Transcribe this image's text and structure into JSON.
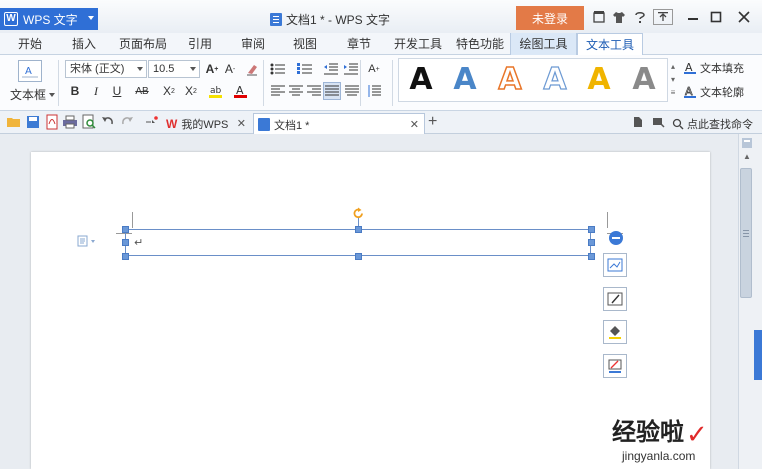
{
  "app": {
    "name": "WPS 文字"
  },
  "window": {
    "title": "文档1 * - WPS 文字",
    "login": "未登录"
  },
  "menu": {
    "items": [
      "开始",
      "插入",
      "页面布局",
      "引用",
      "审阅",
      "视图",
      "章节",
      "开发工具",
      "特色功能",
      "绘图工具",
      "文本工具"
    ],
    "active": "文本工具"
  },
  "ribbon": {
    "textbox_label": "文本框",
    "font_name": "宋体 (正文)",
    "font_size": "10.5",
    "text_fill_label": "文本填充",
    "text_outline_label": "文本轮廓",
    "wordart_styles": [
      {
        "color": "#111111",
        "style": "solid"
      },
      {
        "color": "#4a86c8",
        "style": "solid"
      },
      {
        "color": "#e8762a",
        "style": "outline"
      },
      {
        "color": "#6d9ad3",
        "style": "outline"
      },
      {
        "color": "#f0b400",
        "style": "solid"
      },
      {
        "color": "#888888",
        "style": "solid"
      }
    ]
  },
  "tabs": [
    {
      "label": "我的WPS"
    },
    {
      "label": "文档1 *"
    }
  ],
  "search": {
    "label": "点此查找命令"
  },
  "document": {
    "paragraph_mark": "↵"
  },
  "watermark": {
    "text": "经验啦",
    "check": "✓",
    "url": "jingyanla.com"
  },
  "colors": {
    "accent": "#2f6fd6",
    "login_bg": "#e37a47",
    "handle": "#6a98d8"
  }
}
